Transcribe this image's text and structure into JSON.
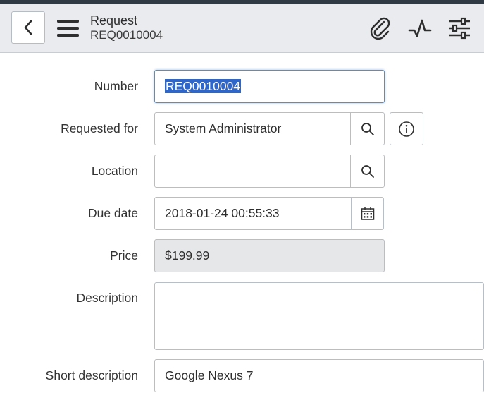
{
  "header": {
    "title": "Request",
    "record_number": "REQ0010004",
    "icons": [
      "chevron-left-icon",
      "hamburger-menu-icon",
      "paperclip-icon",
      "activity-pulse-icon",
      "sliders-icon"
    ]
  },
  "form": {
    "number": {
      "label": "Number",
      "value": "REQ0010004"
    },
    "requested_for": {
      "label": "Requested for",
      "value": "System Administrator"
    },
    "location": {
      "label": "Location",
      "value": ""
    },
    "due_date": {
      "label": "Due date",
      "value": "2018-01-24 00:55:33"
    },
    "price": {
      "label": "Price",
      "value": "$199.99"
    },
    "description": {
      "label": "Description",
      "value": ""
    },
    "short_description": {
      "label": "Short description",
      "value": "Google Nexus 7"
    }
  },
  "colors": {
    "header_bg": "#e9ebee",
    "focus_border": "#4d8fdc",
    "selection": "#2f66c9",
    "readonly_bg": "#e6e7e9"
  }
}
